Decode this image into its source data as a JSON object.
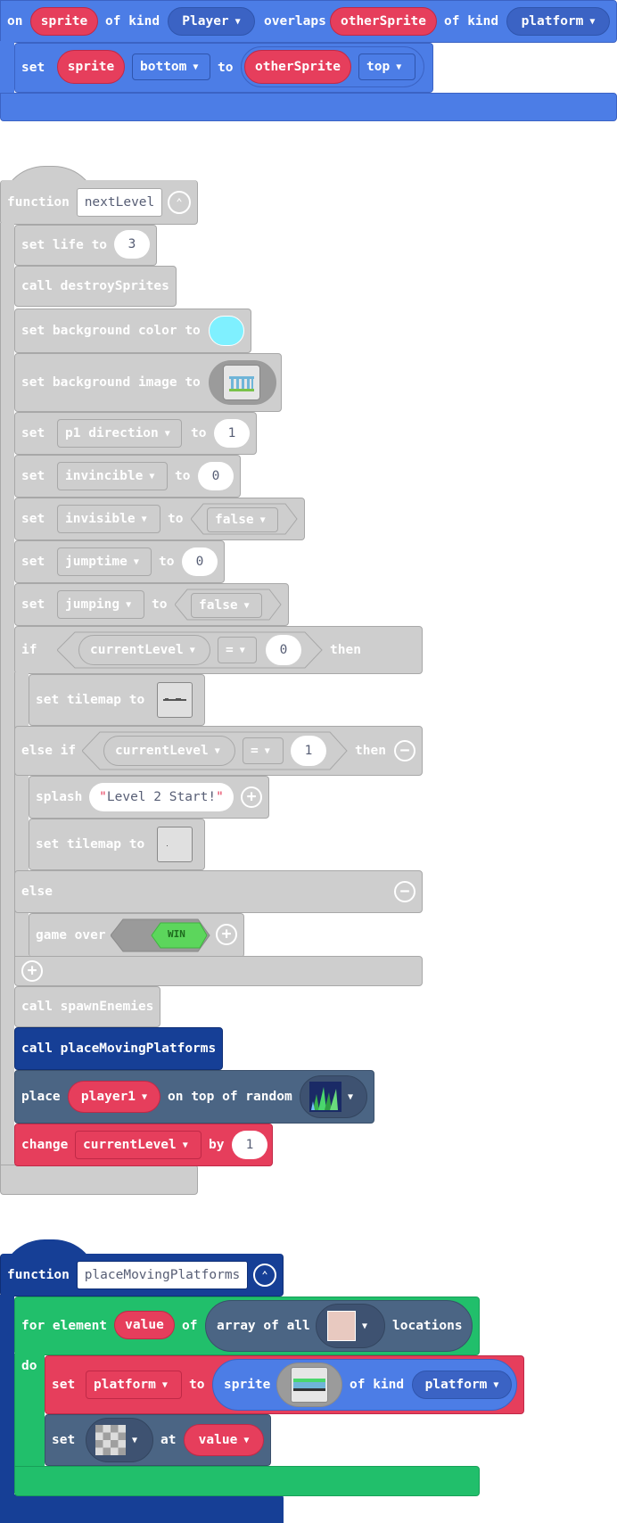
{
  "overlap_event": {
    "on": "on",
    "sprite": "sprite",
    "of_kind_1": "of kind",
    "kind_player": "Player",
    "overlaps": "overlaps",
    "other_sprite": "otherSprite",
    "of_kind_2": "of kind",
    "kind_platform": "platform",
    "set": "set",
    "set_sprite": "sprite",
    "prop_bottom": "bottom",
    "to": "to",
    "set_other": "otherSprite",
    "prop_top": "top"
  },
  "next_level": {
    "function": "function",
    "name": "nextLevel",
    "set_life": "set life to",
    "life_value": "3",
    "call_destroy": "call destroySprites",
    "set_bg_color": "set background color to",
    "bg_color": "#7ff0ff",
    "set_bg_image": "set background image to",
    "set1": "set",
    "var_p1_direction": "p1 direction",
    "to1": "to",
    "val1": "1",
    "set2": "set",
    "var_invincible": "invincible",
    "to2": "to",
    "val2": "0",
    "set3": "set",
    "var_invisible": "invisible",
    "to3": "to",
    "val3": "false",
    "set4": "set",
    "var_jumptime": "jumptime",
    "to4": "to",
    "val4": "0",
    "set5": "set",
    "var_jumping": "jumping",
    "to5": "to",
    "val5": "false",
    "if": "if",
    "if_var": "currentLevel",
    "if_op": "=",
    "if_val": "0",
    "then": "then",
    "set_tilemap_1": "set tilemap to",
    "else_if": "else if",
    "elif_var": "currentLevel",
    "elif_op": "=",
    "elif_val": "1",
    "then2": "then",
    "splash": "splash",
    "splash_quote_open": "\"",
    "splash_text": "Level 2 Start!",
    "splash_quote_close": "\"",
    "set_tilemap_2": "set tilemap to",
    "else": "else",
    "game_over": "game over",
    "win": "WIN",
    "call_spawn": "call spawnEnemies",
    "call_place": "call placeMovingPlatforms",
    "place": "place",
    "player1": "player1",
    "on_top_random": "on top of random",
    "change": "change",
    "change_var": "currentLevel",
    "by": "by",
    "by_val": "1"
  },
  "place_moving_platforms": {
    "function": "function",
    "name": "placeMovingPlatforms",
    "for_element": "for element",
    "value": "value",
    "of": "of",
    "array_of_all": "array of all",
    "locations": "locations",
    "do": "do",
    "set": "set",
    "platform_var": "platform",
    "to": "to",
    "sprite": "sprite",
    "of_kind": "of kind",
    "kind_platform": "platform",
    "set2": "set",
    "at": "at",
    "value2": "value"
  },
  "colors": {
    "sprites_blue": "#4c7de6",
    "sprite_red": "#e63e5c",
    "function_gray": "#cecece",
    "scene_dark_blue": "#163f96",
    "scene_slate": "#4b6584",
    "loops_green": "#21bf6b",
    "wrapper_slate": "#3e5271"
  }
}
